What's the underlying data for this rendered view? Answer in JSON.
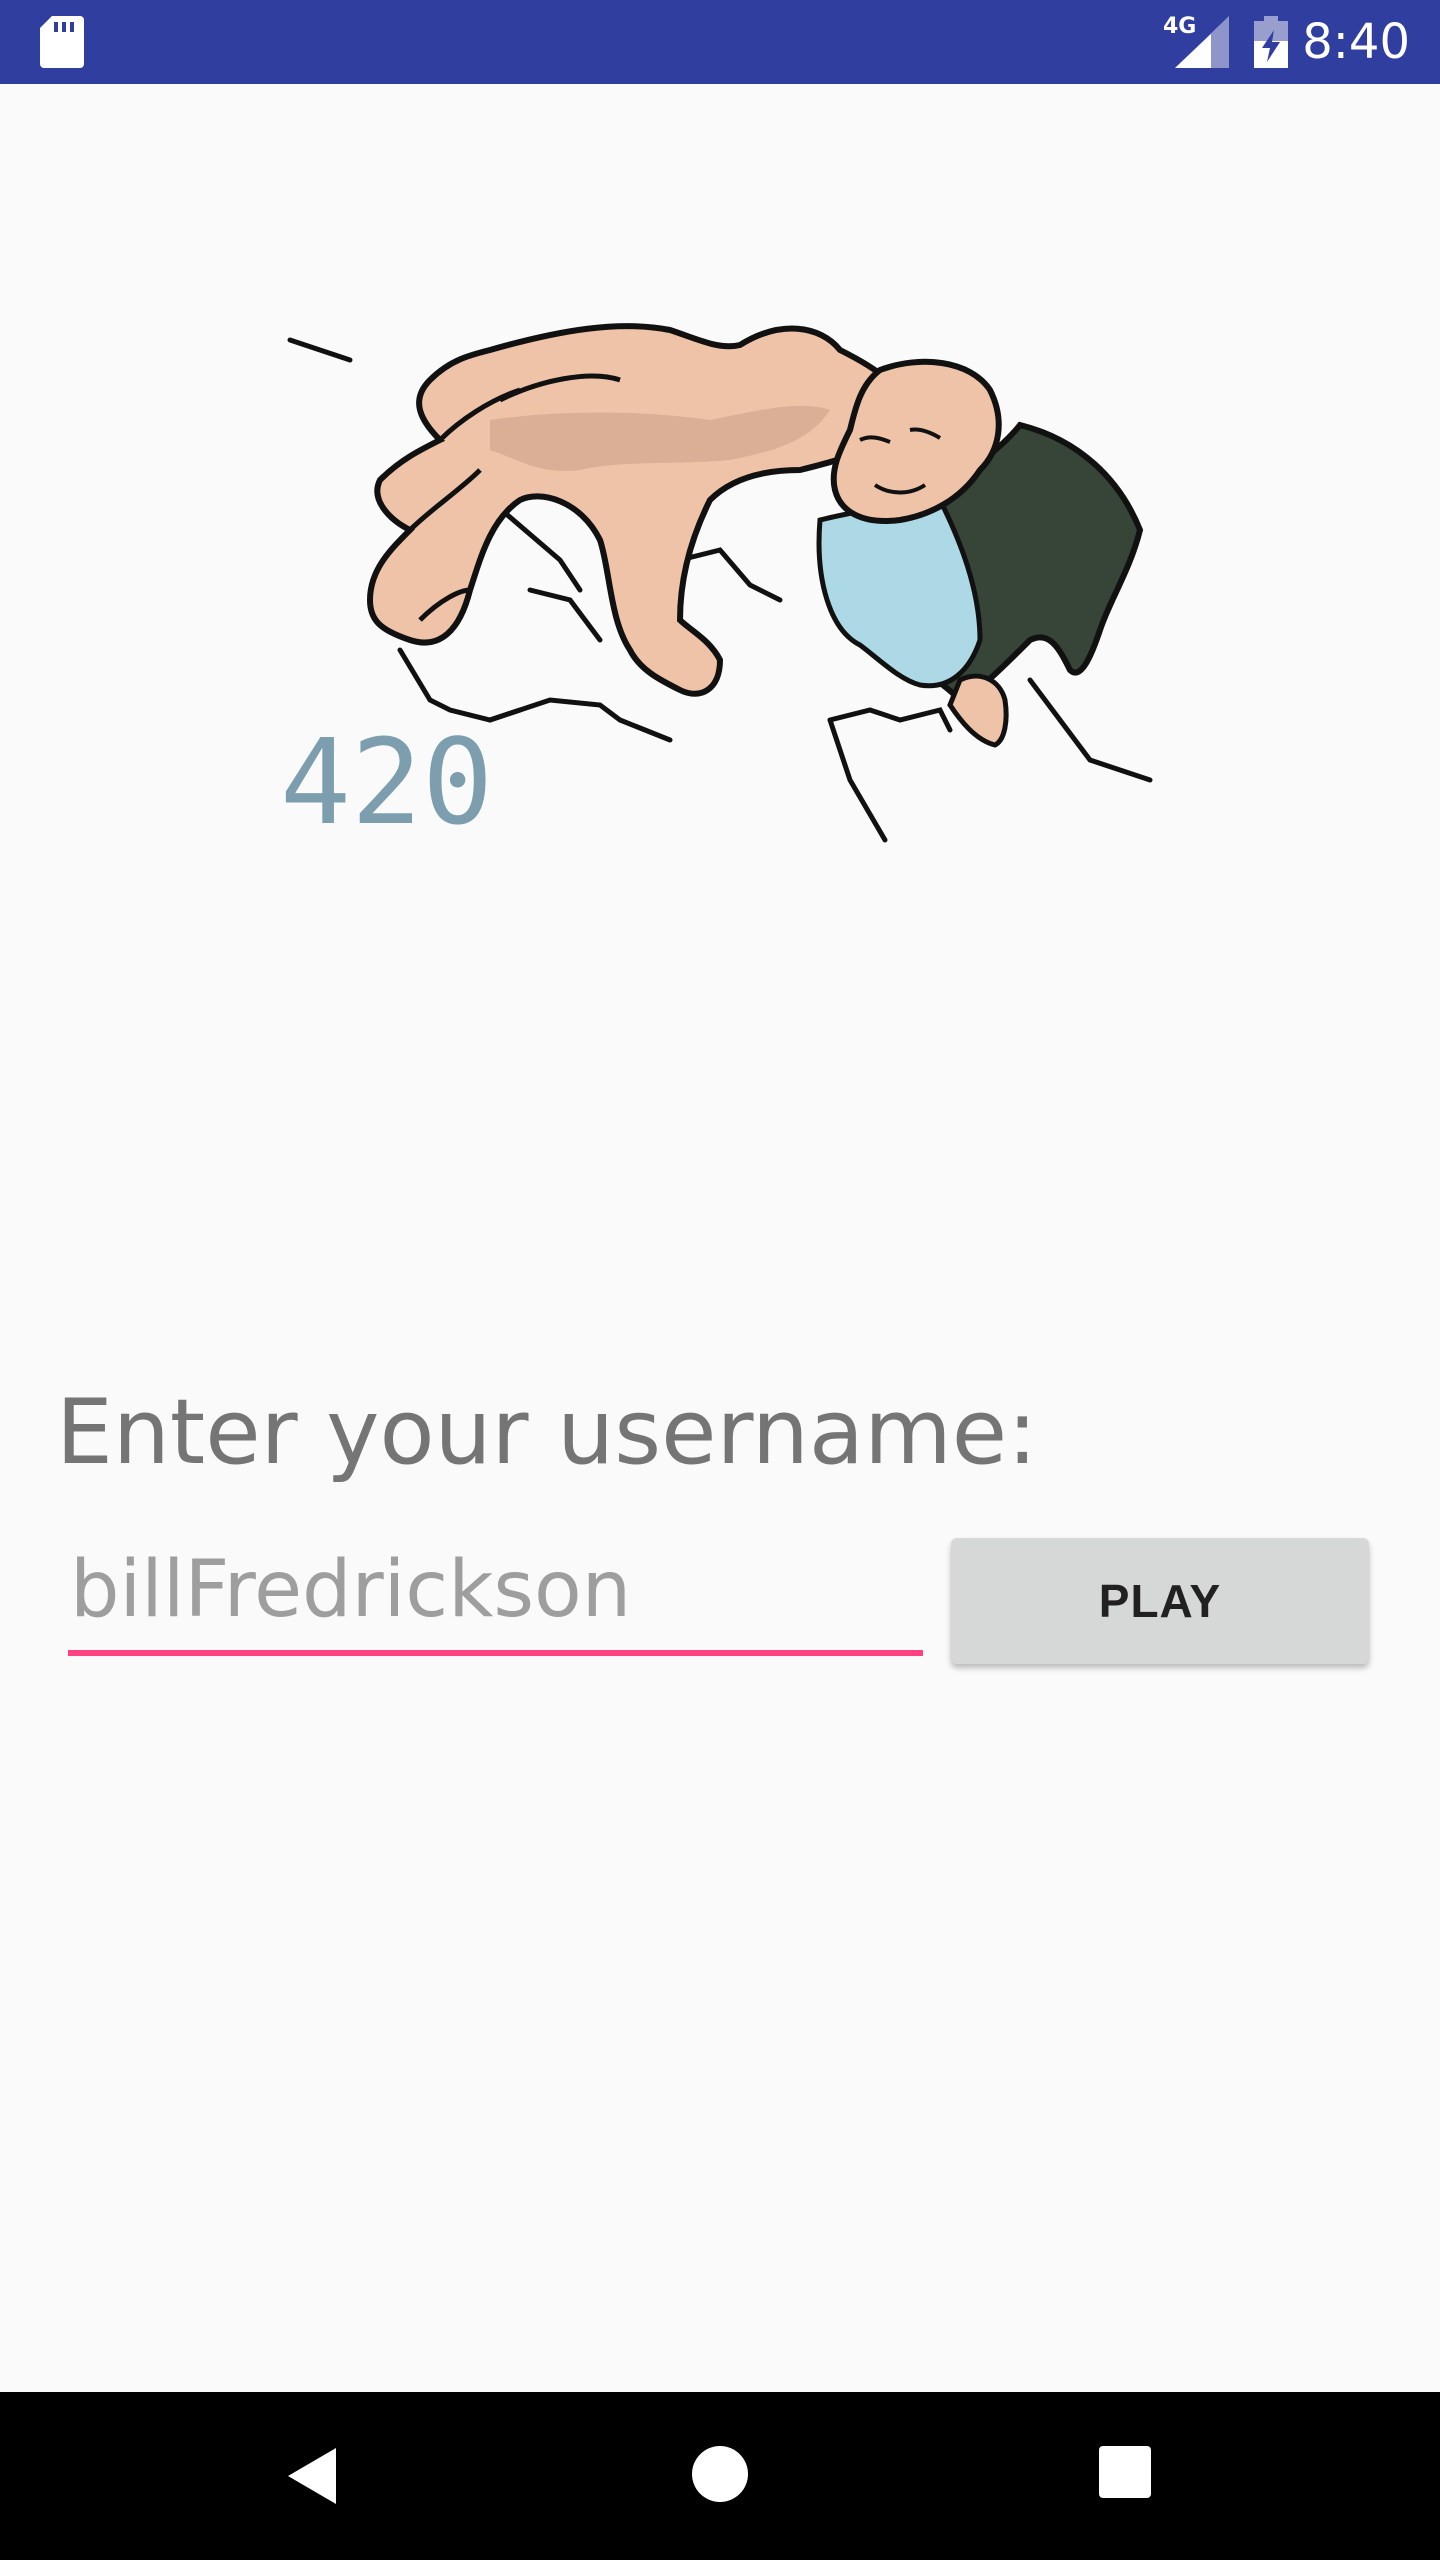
{
  "status_bar": {
    "network_type": "4G",
    "time": "8:40",
    "background_color": "#303f9f",
    "icons": [
      "sd-card-icon",
      "signal-icon",
      "battery-charging-icon"
    ]
  },
  "main": {
    "score": "420",
    "prompt_label": "Enter your username:",
    "username_value": "billFredrickson",
    "play_button_label": "PLAY",
    "accent_color": "#ff4081",
    "illustration_icon": "giant-hand-and-bald-man-illustration"
  },
  "nav_bar": {
    "icons": [
      "back-icon",
      "home-icon",
      "recents-icon"
    ]
  }
}
